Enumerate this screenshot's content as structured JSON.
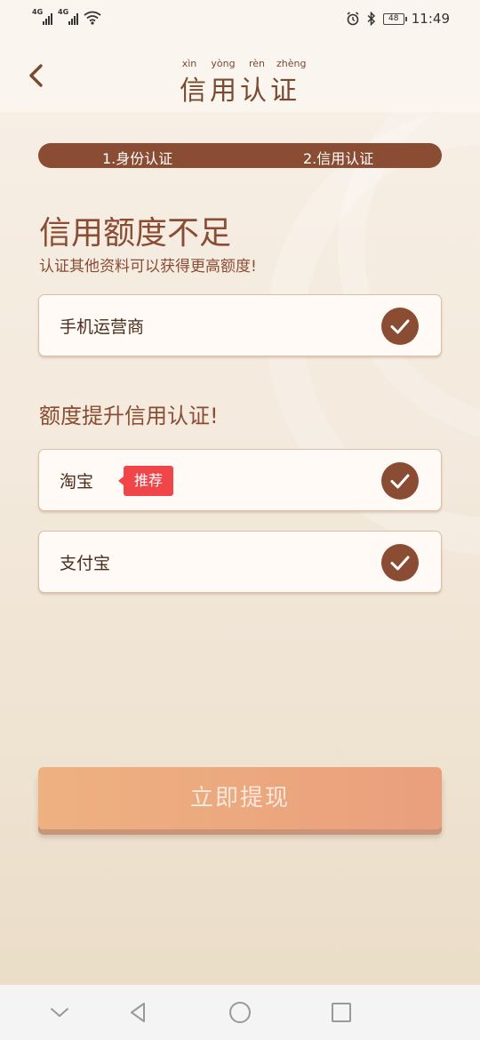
{
  "status_bar": {
    "network1": "4G",
    "network2": "4G",
    "battery": "48",
    "time": "11:49"
  },
  "header": {
    "pinyin": [
      "xìn",
      "yòng",
      "rèn",
      "zhèng"
    ],
    "title": "信用认证"
  },
  "steps": {
    "step1": "1.身份认证",
    "step2": "2.信用认证"
  },
  "main": {
    "heading": "信用额度不足",
    "subheading": "认证其他资料可以获得更高额度!",
    "items_primary": [
      {
        "label": "手机运营商",
        "checked": true
      }
    ],
    "section2_heading": "额度提升信用认证!",
    "items_secondary": [
      {
        "label": "淘宝",
        "badge": "推荐",
        "checked": true
      },
      {
        "label": "支付宝",
        "checked": true
      }
    ],
    "submit_label": "立即提现"
  },
  "colors": {
    "brand": "#8a4d33",
    "badge": "#f0464a",
    "button_start": "#eeb180",
    "button_end": "#ea9f7d"
  }
}
